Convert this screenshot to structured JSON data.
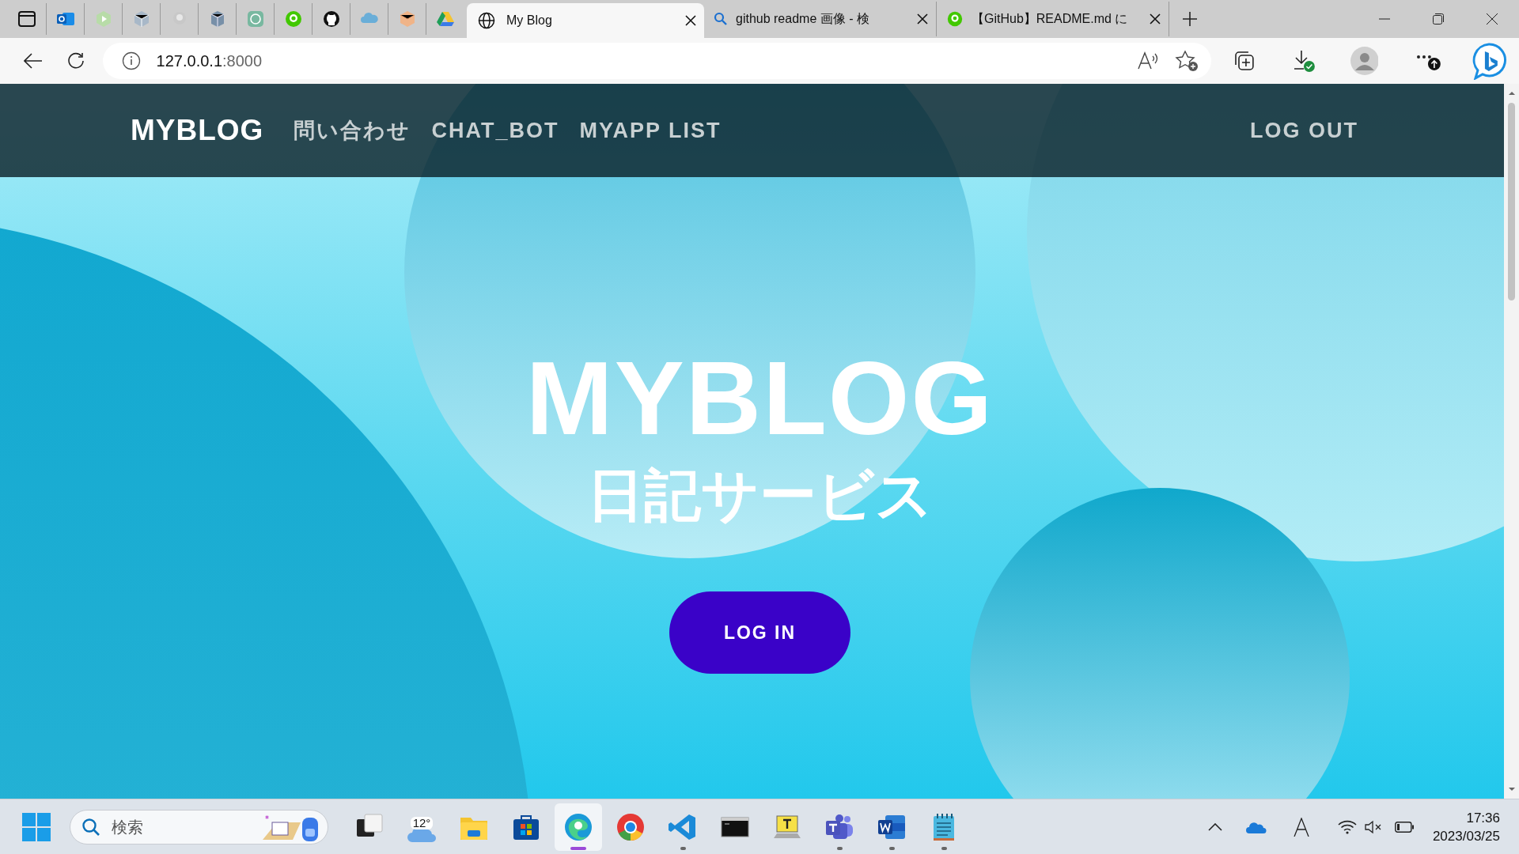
{
  "browser": {
    "tabs": [
      {
        "title": "My Blog",
        "selected": true
      },
      {
        "title": "github readme 画像 - 検",
        "selected": false
      },
      {
        "title": "【GitHub】README.md に",
        "selected": false
      }
    ],
    "address": {
      "host": "127.0.0.1",
      "port": ":8000"
    }
  },
  "page": {
    "navbar": {
      "brand": "MYBLOG",
      "links": [
        "問い合わせ",
        "CHAT_BOT",
        "MYAPP LIST"
      ],
      "logout": "LOG OUT"
    },
    "hero": {
      "title": "MYBLOG",
      "subtitle": "日記サービス",
      "button": "LOG IN"
    }
  },
  "taskbar": {
    "search": {
      "placeholder": "検索"
    },
    "weather": "12°",
    "apps": [
      {
        "kind": "taskview",
        "running": false,
        "selected": false
      },
      {
        "kind": "weather",
        "running": false,
        "selected": false
      },
      {
        "kind": "files",
        "running": false,
        "selected": false
      },
      {
        "kind": "store",
        "running": false,
        "selected": false
      },
      {
        "kind": "edge",
        "running": true,
        "selected": true
      },
      {
        "kind": "chrome",
        "running": false,
        "selected": false
      },
      {
        "kind": "vscode",
        "running": true,
        "selected": false
      },
      {
        "kind": "terminal",
        "running": false,
        "selected": false
      },
      {
        "kind": "typing",
        "running": false,
        "selected": false
      },
      {
        "kind": "teams",
        "running": true,
        "selected": false
      },
      {
        "kind": "word",
        "running": true,
        "selected": false
      },
      {
        "kind": "notepad",
        "running": true,
        "selected": false
      }
    ],
    "time": "17:36",
    "date": "2023/03/25"
  }
}
